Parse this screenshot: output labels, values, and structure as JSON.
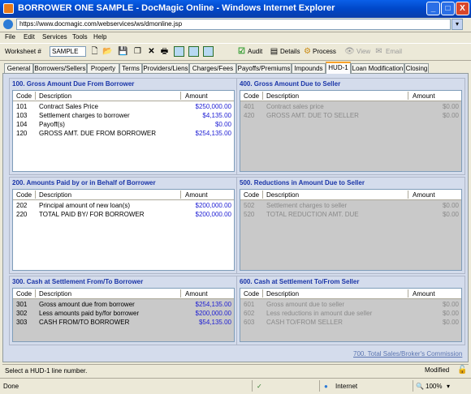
{
  "window": {
    "title": "BORROWER ONE SAMPLE - DocMagic Online - Windows Internet Explorer",
    "url": "https://www.docmagic.com/webservices/ws/dmonline.jsp",
    "min": "_",
    "max": "□",
    "close": "X"
  },
  "menu": [
    "File",
    "Edit",
    "Services",
    "Tools",
    "Help"
  ],
  "toolbar": {
    "worksheet_label": "Worksheet #",
    "worksheet_value": "SAMPLE",
    "audit": "Audit",
    "details": "Details",
    "process": "Process",
    "view": "View",
    "email": "Email"
  },
  "tabs": [
    "General",
    "Borrowers/Sellers",
    "Property",
    "Terms",
    "Providers/Liens",
    "Charges/Fees",
    "Payoffs/Premiums",
    "Impounds",
    "HUD-1",
    "Loan Modification",
    "Closing"
  ],
  "active_tab": "HUD-1",
  "columns": {
    "code": "Code",
    "description": "Description",
    "amount": "Amount"
  },
  "sections": {
    "s100": {
      "title": "100. Gross Amount Due From Borrower",
      "rows": [
        {
          "code": "101",
          "desc": "Contract Sales Price",
          "amount": "$250,000.00"
        },
        {
          "code": "103",
          "desc": "Settlement charges to borrower",
          "amount": "$4,135.00"
        },
        {
          "code": "104",
          "desc": "Payoff(s)",
          "amount": "$0.00"
        },
        {
          "code": "120",
          "desc": "GROSS AMT. DUE FROM BORROWER",
          "amount": "$254,135.00"
        }
      ]
    },
    "s400": {
      "title": "400. Gross Amount Due to Seller",
      "rows": [
        {
          "code": "401",
          "desc": "Contract sales price",
          "amount": "$0.00"
        },
        {
          "code": "420",
          "desc": "GROSS AMT. DUE TO SELLER",
          "amount": "$0.00"
        }
      ]
    },
    "s200": {
      "title": "200. Amounts Paid by or in Behalf of Borrower",
      "rows": [
        {
          "code": "202",
          "desc": "Principal amount of new loan(s)",
          "amount": "$200,000.00"
        },
        {
          "code": "220",
          "desc": "TOTAL PAID BY/ FOR BORROWER",
          "amount": "$200,000.00"
        }
      ]
    },
    "s500": {
      "title": "500. Reductions in Amount Due to Seller",
      "rows": [
        {
          "code": "502",
          "desc": "Settlement charges to seller",
          "amount": "$0.00"
        },
        {
          "code": "520",
          "desc": "TOTAL REDUCTION AMT. DUE",
          "amount": "$0.00"
        }
      ]
    },
    "s300": {
      "title": "300. Cash at Settlement From/To Borrower",
      "rows": [
        {
          "code": "301",
          "desc": "Gross amount due from borrower",
          "amount": "$254,135.00"
        },
        {
          "code": "302",
          "desc": "Less amounts paid by/for borrower",
          "amount": "$200,000.00"
        },
        {
          "code": "303",
          "desc": "CASH FROM/TO BORROWER",
          "amount": "$54,135.00"
        }
      ]
    },
    "s600": {
      "title": "600. Cash at Settlement To/From Seller",
      "rows": [
        {
          "code": "601",
          "desc": "Gross amount due to seller",
          "amount": "$0.00"
        },
        {
          "code": "602",
          "desc": "Less reductions in amount due seller",
          "amount": "$0.00"
        },
        {
          "code": "603",
          "desc": "CASH TO/FROM SELLER",
          "amount": "$0.00"
        }
      ]
    }
  },
  "link_700": "700. Total Sales/Broker's Commission",
  "status": {
    "message": "Select a HUD-1 line number.",
    "modified": "Modified"
  },
  "ie_status": {
    "done": "Done",
    "zone": "Internet",
    "zoom": "100%"
  },
  "colors": {
    "title_blue": "#1A35A8",
    "amount_blue": "#1D1DD3",
    "tab_accent": "#F9A22A"
  }
}
